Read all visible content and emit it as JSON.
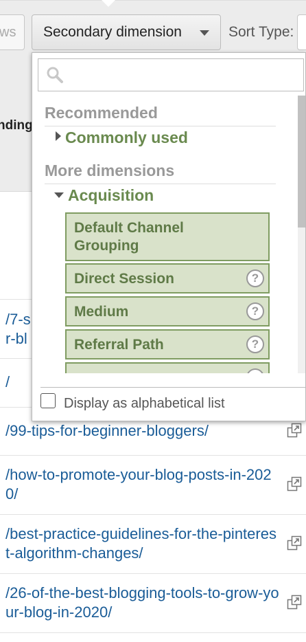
{
  "toolbar": {
    "rows_partial": "ws",
    "secondary_dimension_label": "Secondary dimension",
    "sort_type_label": "Sort Type:"
  },
  "table": {
    "column_header_partial": "nding",
    "rows": [
      {
        "path": "/7-s\nr-bl"
      },
      {
        "path": "/"
      },
      {
        "path": "/99-tips-for-beginner-bloggers/"
      },
      {
        "path": "/how-to-promote-your-blog-posts-in-2020/"
      },
      {
        "path": "/best-practice-guidelines-for-the-pinterest-algorithm-changes/"
      },
      {
        "path": "/26-of-the-best-blogging-tools-to-grow-your-blog-in-2020/"
      }
    ]
  },
  "dropdown": {
    "search_value": "",
    "recommended_heading": "Recommended",
    "commonly_used": "Commonly used",
    "more_dimensions_heading": "More dimensions",
    "acquisition": "Acquisition",
    "dimensions": [
      {
        "label": "Default Channel Grouping",
        "help": ""
      },
      {
        "label": "Direct Session",
        "help": "?"
      },
      {
        "label": "Medium",
        "help": "?"
      },
      {
        "label": "Referral Path",
        "help": "?"
      }
    ],
    "alphabetical_label": "Display as alphabetical list"
  },
  "colors": {
    "link": "#1a5c97",
    "dimension_bg": "#d9e2ca",
    "dimension_border": "#7f9c61",
    "group_text": "#6a8a4f"
  }
}
